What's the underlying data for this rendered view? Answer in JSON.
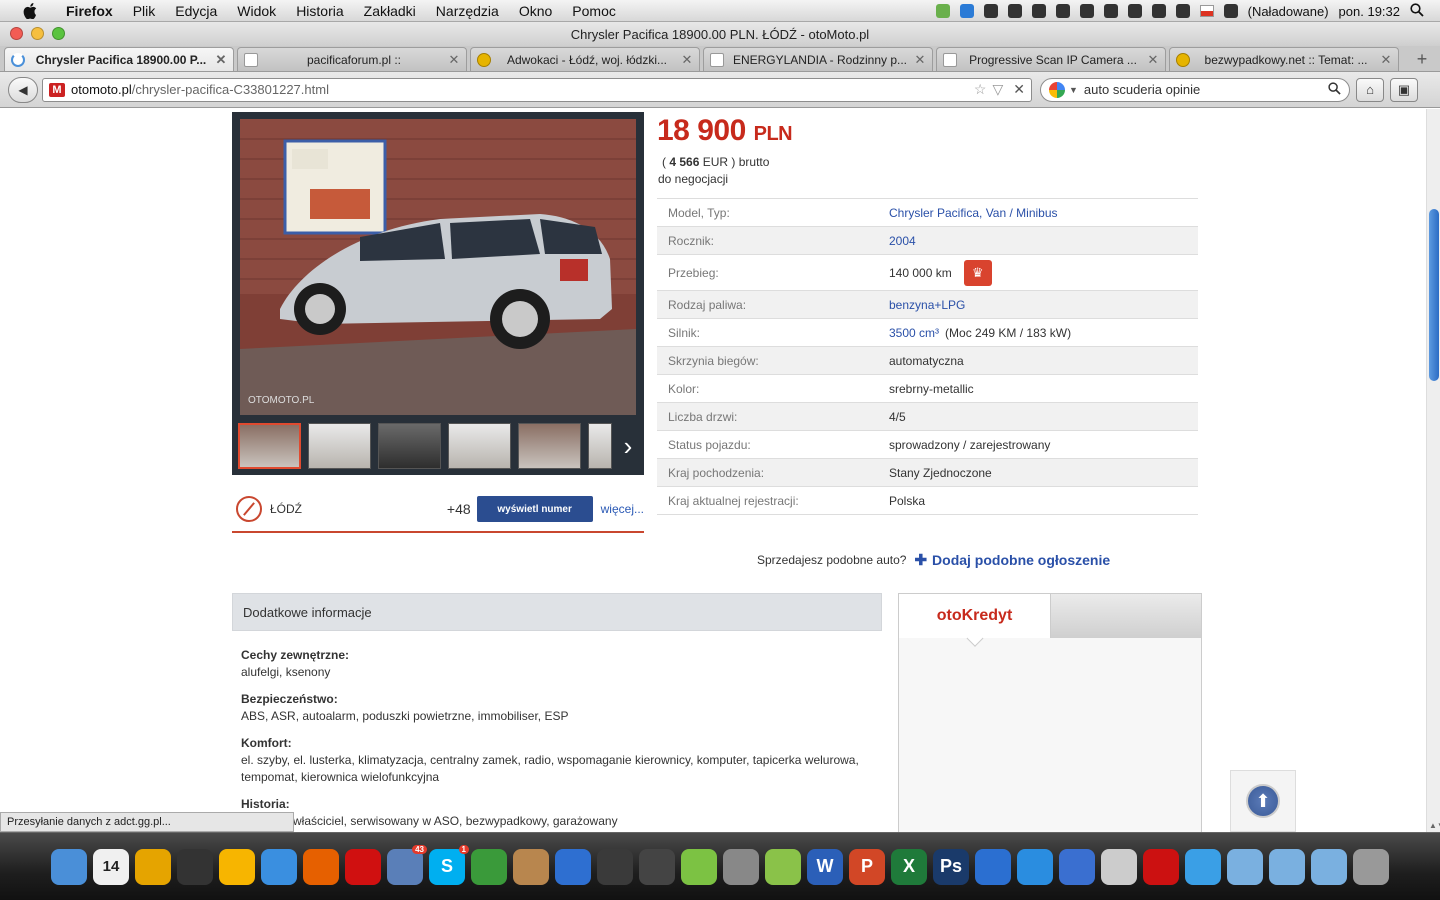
{
  "menubar": {
    "app": "Firefox",
    "items": [
      "Plik",
      "Edycja",
      "Widok",
      "Historia",
      "Zakładki",
      "Narzędzia",
      "Okno",
      "Pomoc"
    ],
    "battery": "(Naładowane)",
    "clock": "pon. 19:32"
  },
  "window": {
    "title": "Chrysler Pacifica 18900.00 PLN. ŁÓDŹ - otoMoto.pl"
  },
  "tabs": [
    {
      "label": "Chrysler Pacifica 18900.00 P...",
      "active": true
    },
    {
      "label": "pacificaforum.pl ::"
    },
    {
      "label": "Adwokaci - Łódź, woj. łódzki..."
    },
    {
      "label": "ENERGYLANDIA - Rodzinny p..."
    },
    {
      "label": "Progressive Scan IP Camera ..."
    },
    {
      "label": "bezwypadkowy.net :: Temat: ..."
    }
  ],
  "nav": {
    "url_domain": "otomoto.pl",
    "url_path": "/chrysler-pacifica-C33801227.html",
    "search_query": "auto scuderia opinie"
  },
  "listing": {
    "price": "18 900",
    "currency": "PLN",
    "eur_prefix": "(",
    "eur_value": "4 566",
    "eur_suffix": "EUR ) brutto",
    "negotiable": "do negocjacji",
    "location": "ŁÓDŹ",
    "phone_prefix": "+48",
    "show_number": "wyświetl numer",
    "more": "więcej...",
    "watermark": "OTOMOTO.PL",
    "params": [
      {
        "label": "Model, Typ:",
        "value": "Chrysler Pacifica, Van / Minibus",
        "link": true
      },
      {
        "label": "Rocznik:",
        "value": "2004",
        "link": true
      },
      {
        "label": "Przebieg:",
        "value": "140 000 km",
        "link": false,
        "icon": "fire"
      },
      {
        "label": "Rodzaj paliwa:",
        "value": "benzyna+LPG",
        "link": true
      },
      {
        "label": "Silnik:",
        "value": "3500 cm³",
        "link": true,
        "extra": "(Moc 249 KM / 183 kW)"
      },
      {
        "label": "Skrzynia biegów:",
        "value": "automatyczna",
        "link": false
      },
      {
        "label": "Kolor:",
        "value": "srebrny-metallic",
        "link": false
      },
      {
        "label": "Liczba drzwi:",
        "value": "4/5",
        "link": false
      },
      {
        "label": "Status pojazdu:",
        "value": "sprowadzony / zarejestrowany",
        "link": false
      },
      {
        "label": "Kraj pochodzenia:",
        "value": "Stany Zjednoczone",
        "link": false
      },
      {
        "label": "Kraj aktualnej rejestracji:",
        "value": "Polska",
        "link": false
      }
    ],
    "sell_question": "Sprzedajesz podobne auto?",
    "sell_link": "Dodaj podobne ogłoszenie"
  },
  "info": {
    "heading": "Dodatkowe informacje",
    "blocks": [
      {
        "title": "Cechy zewnętrzne:",
        "text": "alufelgi, ksenony"
      },
      {
        "title": "Bezpieczeństwo:",
        "text": "ABS, ASR, autoalarm, poduszki powietrzne, immobiliser, ESP"
      },
      {
        "title": "Komfort:",
        "text": "el. szyby, el. lusterka, klimatyzacja, centralny zamek, radio, wspomaganie kierownicy, komputer, tapicerka welurowa, tempomat, kierownica wielofunkcyjna"
      },
      {
        "title": "Historia:",
        "text": "właściciel, serwisowany w ASO, bezwypadkowy, garażowany"
      }
    ]
  },
  "kredyt": {
    "tab": "otoKredyt"
  },
  "status": "Przesyłanie danych z adct.gg.pl...",
  "dock": [
    {
      "name": "finder",
      "color": "#4a8fd8"
    },
    {
      "name": "calendar",
      "color": "#f0f0f0",
      "label": "14"
    },
    {
      "name": "stopwatch",
      "color": "#e5a400"
    },
    {
      "name": "dashboard",
      "color": "#333"
    },
    {
      "name": "sun",
      "color": "#f7b500"
    },
    {
      "name": "safari",
      "color": "#3a8fe0"
    },
    {
      "name": "firefox",
      "color": "#e66000"
    },
    {
      "name": "opera",
      "color": "#d01010"
    },
    {
      "name": "mail",
      "color": "#5a7fb8",
      "badge": "43"
    },
    {
      "name": "skype",
      "color": "#00aff0",
      "label": "S",
      "badge": "1"
    },
    {
      "name": "adium",
      "color": "#3a9a3a"
    },
    {
      "name": "addressbook",
      "color": "#b8864e"
    },
    {
      "name": "itunes",
      "color": "#2e6fd1"
    },
    {
      "name": "audio",
      "color": "#3a3a3a"
    },
    {
      "name": "music",
      "color": "#444"
    },
    {
      "name": "player",
      "color": "#7cc243"
    },
    {
      "name": "prefs",
      "color": "#888"
    },
    {
      "name": "android",
      "color": "#8ac249"
    },
    {
      "name": "word",
      "color": "#2b5fb8",
      "label": "W"
    },
    {
      "name": "powerpoint",
      "color": "#d24726",
      "label": "P"
    },
    {
      "name": "excel",
      "color": "#1f7a3a",
      "label": "X"
    },
    {
      "name": "photoshop",
      "color": "#1a3a6a",
      "label": "Ps"
    },
    {
      "name": "drop",
      "color": "#2b6fd1"
    },
    {
      "name": "quicktime",
      "color": "#2a8de0"
    },
    {
      "name": "sp",
      "color": "#3a6fd0"
    },
    {
      "name": "preview",
      "color": "#ccc"
    },
    {
      "name": "acrobat",
      "color": "#c11"
    },
    {
      "name": "downloads",
      "color": "#3a9fe6"
    },
    {
      "name": "folder1",
      "color": "#7ab0e0"
    },
    {
      "name": "folder2",
      "color": "#7ab0e0"
    },
    {
      "name": "folder3",
      "color": "#7ab0e0"
    },
    {
      "name": "trash",
      "color": "#999"
    }
  ]
}
